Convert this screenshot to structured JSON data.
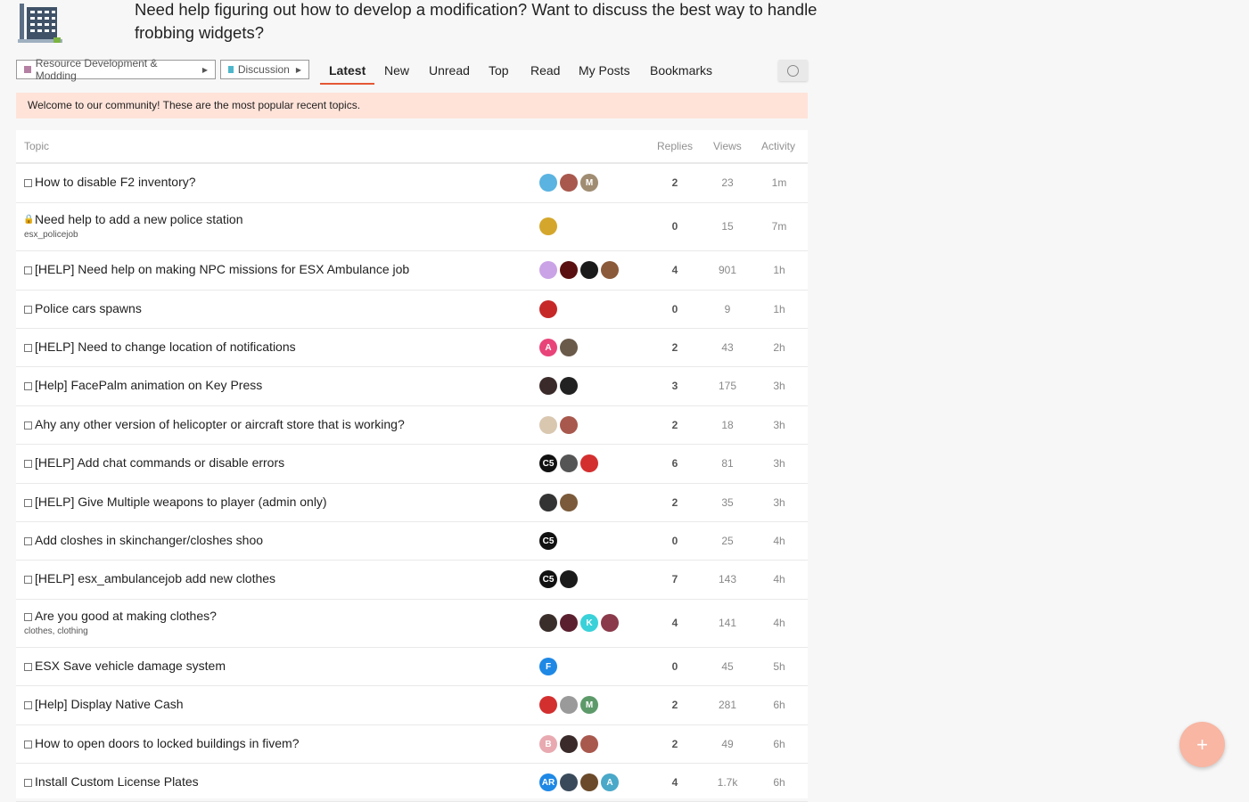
{
  "header": {
    "message": "Need help figuring out how to develop a modification? Want to discuss the best way to handle frobbing widgets?"
  },
  "nav": {
    "category": {
      "label": "Resource Development & Modding",
      "color": "#b480a3"
    },
    "subcategory": {
      "label": "Discussion",
      "color": "#4db6cc"
    },
    "tabs": [
      "Latest",
      "New",
      "Unread",
      "Top",
      "Read",
      "My Posts",
      "Bookmarks"
    ],
    "active_tab": "Latest"
  },
  "banner": {
    "text": "Welcome to our community! These are the most popular recent topics."
  },
  "table": {
    "headers": {
      "topic": "Topic",
      "replies": "Replies",
      "views": "Views",
      "activity": "Activity"
    },
    "rows": [
      {
        "title": "How to disable F2 inventory?",
        "tags": "",
        "locked": false,
        "replies": "2",
        "views": "23",
        "activity": "1m",
        "avatars": [
          {
            "color": "#5ab3e0",
            "text": ""
          },
          {
            "color": "#a8584d",
            "text": ""
          },
          {
            "color": "#a08c72",
            "text": "M"
          }
        ]
      },
      {
        "title": "Need help to add a new police station",
        "tags": "esx_policejob",
        "locked": true,
        "replies": "0",
        "views": "15",
        "activity": "7m",
        "avatars": [
          {
            "color": "#d4a72c",
            "text": ""
          }
        ]
      },
      {
        "title": "[HELP] Need help on making NPC missions for ESX Ambulance job",
        "tags": "",
        "locked": false,
        "replies": "4",
        "views": "901",
        "activity": "1h",
        "avatars": [
          {
            "color": "#c9a3e6",
            "text": ""
          },
          {
            "color": "#5a1010",
            "text": ""
          },
          {
            "color": "#1a1a1a",
            "text": ""
          },
          {
            "color": "#8a5a3a",
            "text": ""
          }
        ]
      },
      {
        "title": "Police cars spawns",
        "tags": "",
        "locked": false,
        "replies": "0",
        "views": "9",
        "activity": "1h",
        "avatars": [
          {
            "color": "#c62828",
            "text": ""
          }
        ]
      },
      {
        "title": "[HELP] Need to change location of notifications",
        "tags": "",
        "locked": false,
        "replies": "2",
        "views": "43",
        "activity": "2h",
        "avatars": [
          {
            "color": "#e8447a",
            "text": "A"
          },
          {
            "color": "#6a5a4a",
            "text": ""
          }
        ]
      },
      {
        "title": "[Help] FacePalm animation on Key Press",
        "tags": "",
        "locked": false,
        "replies": "3",
        "views": "175",
        "activity": "3h",
        "avatars": [
          {
            "color": "#3a2a2a",
            "text": ""
          },
          {
            "color": "#222222",
            "text": ""
          }
        ]
      },
      {
        "title": "Ahy any other version of helicopter or aircraft store that is working?",
        "tags": "",
        "locked": false,
        "replies": "2",
        "views": "18",
        "activity": "3h",
        "avatars": [
          {
            "color": "#d9c7b0",
            "text": ""
          },
          {
            "color": "#a8584d",
            "text": ""
          }
        ]
      },
      {
        "title": "[HELP] Add chat commands or disable errors",
        "tags": "",
        "locked": false,
        "replies": "6",
        "views": "81",
        "activity": "3h",
        "avatars": [
          {
            "color": "#111111",
            "text": "C5"
          },
          {
            "color": "#555555",
            "text": ""
          },
          {
            "color": "#d32f2f",
            "text": ""
          }
        ]
      },
      {
        "title": "[HELP] Give Multiple weapons to player (admin only)",
        "tags": "",
        "locked": false,
        "replies": "2",
        "views": "35",
        "activity": "3h",
        "avatars": [
          {
            "color": "#333333",
            "text": ""
          },
          {
            "color": "#7a5a3a",
            "text": ""
          }
        ]
      },
      {
        "title": "Add closhes in skinchanger/closhes shoo",
        "tags": "",
        "locked": false,
        "replies": "0",
        "views": "25",
        "activity": "4h",
        "avatars": [
          {
            "color": "#111111",
            "text": "C5"
          }
        ]
      },
      {
        "title": "[HELP] esx_ambulancejob add new clothes",
        "tags": "",
        "locked": false,
        "replies": "7",
        "views": "143",
        "activity": "4h",
        "avatars": [
          {
            "color": "#111111",
            "text": "C5"
          },
          {
            "color": "#1a1a1a",
            "text": ""
          }
        ]
      },
      {
        "title": "Are you good at making clothes?",
        "tags": "clothes, clothing",
        "locked": false,
        "replies": "4",
        "views": "141",
        "activity": "4h",
        "avatars": [
          {
            "color": "#3a2e2a",
            "text": ""
          },
          {
            "color": "#5a2030",
            "text": ""
          },
          {
            "color": "#3ad1d9",
            "text": "K"
          },
          {
            "color": "#8a3a4a",
            "text": ""
          }
        ]
      },
      {
        "title": "ESX Save vehicle damage system",
        "tags": "",
        "locked": false,
        "replies": "0",
        "views": "45",
        "activity": "5h",
        "avatars": [
          {
            "color": "#1e88e5",
            "text": "F"
          }
        ]
      },
      {
        "title": "[Help] Display Native Cash",
        "tags": "",
        "locked": false,
        "replies": "2",
        "views": "281",
        "activity": "6h",
        "avatars": [
          {
            "color": "#d32f2f",
            "text": ""
          },
          {
            "color": "#9a9a9a",
            "text": ""
          },
          {
            "color": "#5d9a6a",
            "text": "M"
          }
        ]
      },
      {
        "title": "How to open doors to locked buildings in fivem?",
        "tags": "",
        "locked": false,
        "replies": "2",
        "views": "49",
        "activity": "6h",
        "avatars": [
          {
            "color": "#e8aab0",
            "text": "B"
          },
          {
            "color": "#3a2a2a",
            "text": ""
          },
          {
            "color": "#a8584d",
            "text": ""
          }
        ]
      },
      {
        "title": "Install Custom License Plates",
        "tags": "",
        "locked": false,
        "replies": "4",
        "views": "1.7k",
        "activity": "6h",
        "avatars": [
          {
            "color": "#1e88e5",
            "text": "AR"
          },
          {
            "color": "#3a4a5a",
            "text": ""
          },
          {
            "color": "#6a4a2a",
            "text": ""
          },
          {
            "color": "#4aa8c8",
            "text": "A"
          }
        ]
      }
    ]
  },
  "fab": {
    "label": "+"
  }
}
